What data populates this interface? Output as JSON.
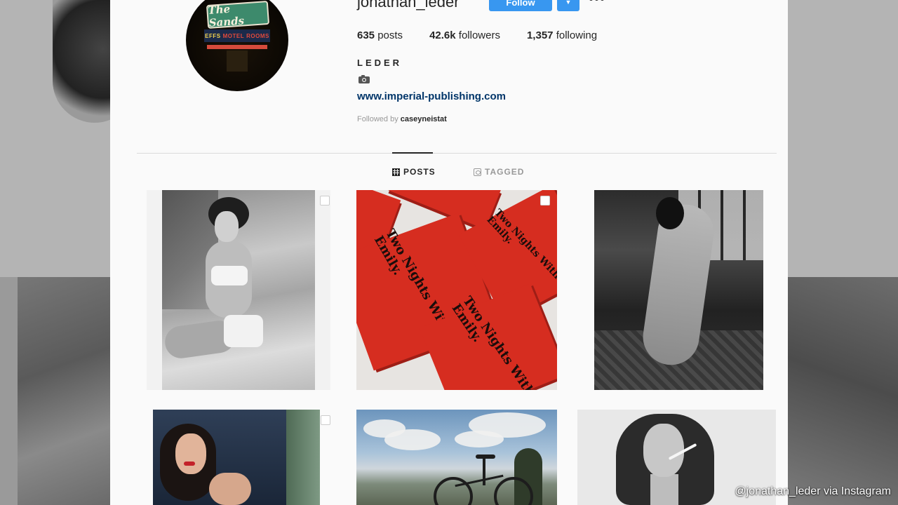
{
  "profile": {
    "username": "jonathan_leder",
    "follow_label": "Follow",
    "dropdown_icon": "chevron-down-icon",
    "more_icon": "more-options-icon",
    "more_glyph": "•••",
    "stats": {
      "posts_count": "635",
      "posts_label": "posts",
      "followers_count": "42.6k",
      "followers_label": "followers",
      "following_count": "1,357",
      "following_label": "following"
    },
    "full_name": "LEDER",
    "bio_icon": "camera-icon",
    "website": "www.imperial-publishing.com",
    "followed_by_prefix": "Followed by",
    "followed_by_user": "caseyneistat"
  },
  "avatar": {
    "sign_top": "The Sands",
    "sign_mid_a": "EFFS",
    "sign_mid_b": "MOTEL",
    "sign_mid_c": "ROOMS"
  },
  "tabs": [
    {
      "label": "POSTS",
      "icon": "grid-icon",
      "active": true
    },
    {
      "label": "TAGGED",
      "icon": "tag-icon",
      "active": false
    }
  ],
  "posts": {
    "book_title": "Two Nights With Emily."
  },
  "watermark": "@jonathan_leder via Instagram",
  "colors": {
    "follow_button": "#3897f0",
    "link": "#003569",
    "book_red": "#d62d20"
  }
}
